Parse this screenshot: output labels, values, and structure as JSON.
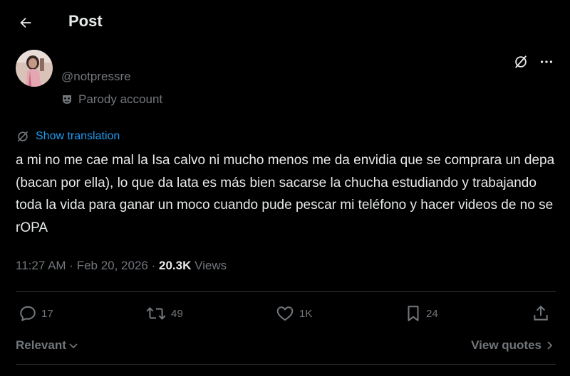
{
  "header": {
    "title": "Post"
  },
  "post": {
    "handle": "@notpressre",
    "badge": "Parody account",
    "translate_label": "Show translation",
    "text": "a mi no me cae mal la Isa calvo ni mucho menos me da envidia que se comprara un depa (bacan por ella), lo que da lata es más bien sacarse la chucha estudiando y trabajando toda la vida para ganar un moco cuando pude pescar mi teléfono y hacer videos de no se rOPA",
    "time": "11:27 AM",
    "sep": " · ",
    "date": "Feb 20, 2026",
    "views_count": "20.3K",
    "views_label": " Views"
  },
  "actions": {
    "replies": "17",
    "reposts": "49",
    "likes": "1K",
    "bookmarks": "24"
  },
  "footer": {
    "sort_label": "Relevant",
    "quotes_label": "View quotes"
  },
  "colors": {
    "background": "#000000",
    "text_primary": "#e7e9ea",
    "text_secondary": "#71767b",
    "accent": "#1d9bf0",
    "divider": "#2f3336"
  },
  "icons": [
    "back-arrow-icon",
    "grok-icon",
    "more-icon",
    "parody-mask-icon",
    "translate-icon",
    "reply-icon",
    "repost-icon",
    "like-icon",
    "bookmark-icon",
    "share-icon",
    "chevron-down-icon",
    "chevron-right-icon"
  ]
}
